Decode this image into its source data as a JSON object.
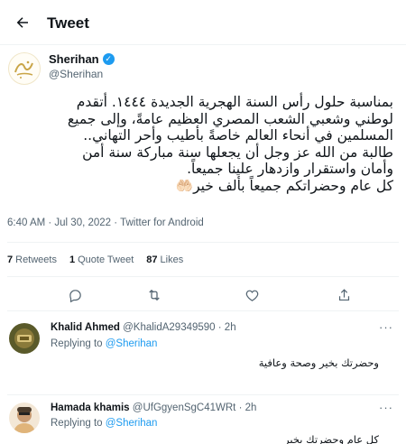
{
  "header": {
    "title": "Tweet"
  },
  "author": {
    "name": "Sherihan",
    "handle": "@Sherihan",
    "verified_mark": "✓",
    "avatar_icon": "sherihan-calligraphy-logo"
  },
  "tweet": {
    "lines": [
      "بمناسبة حلول رأس السنة الهجرية الجديدة ١٤٤٤. أتقدم",
      "لوطني وشعبي الشعب المصري العظيم عامةً، وإلى جميع",
      "المسلمين في  أنحاء العالم خاصةً بأطيب وأحر التهاني..",
      "طالبة من  الله عز وجل أن يجعلها سنة مباركة سنة أمن",
      "وأمان واستقرار وازدهار علينا جميعاً.",
      "كل عام وحضراتكم جميعاً بألف خير🤲🏻"
    ],
    "meta": "6:40 AM · Jul 30, 2022 · Twitter for Android"
  },
  "stats": {
    "retweets_count": "7",
    "retweets_label": "Retweets",
    "quotes_count": "1",
    "quotes_label": "Quote Tweet",
    "likes_count": "87",
    "likes_label": "Likes"
  },
  "actions": {
    "icons": [
      "reply-icon",
      "retweet-icon",
      "like-icon",
      "share-icon"
    ]
  },
  "replies": [
    {
      "name": "Khalid Ahmed",
      "handle": "@KhalidA29349590",
      "time": "· 2h",
      "replying_prefix": "Replying to",
      "replying_to": "@Sherihan",
      "text": "وحضرتك بخير وصحة وعافية",
      "more": "···"
    },
    {
      "name": "Hamada khamis",
      "handle": "@UfGgyenSgC41WRt",
      "time": "· 2h",
      "replying_prefix": "Replying to",
      "replying_to": "@Sherihan",
      "text": "كل عام وحضرتك بخير",
      "more": "···"
    }
  ],
  "colors": {
    "accent": "#1d9bf0",
    "text": "#0f1419",
    "muted": "#536471",
    "divider": "#eff3f4"
  }
}
